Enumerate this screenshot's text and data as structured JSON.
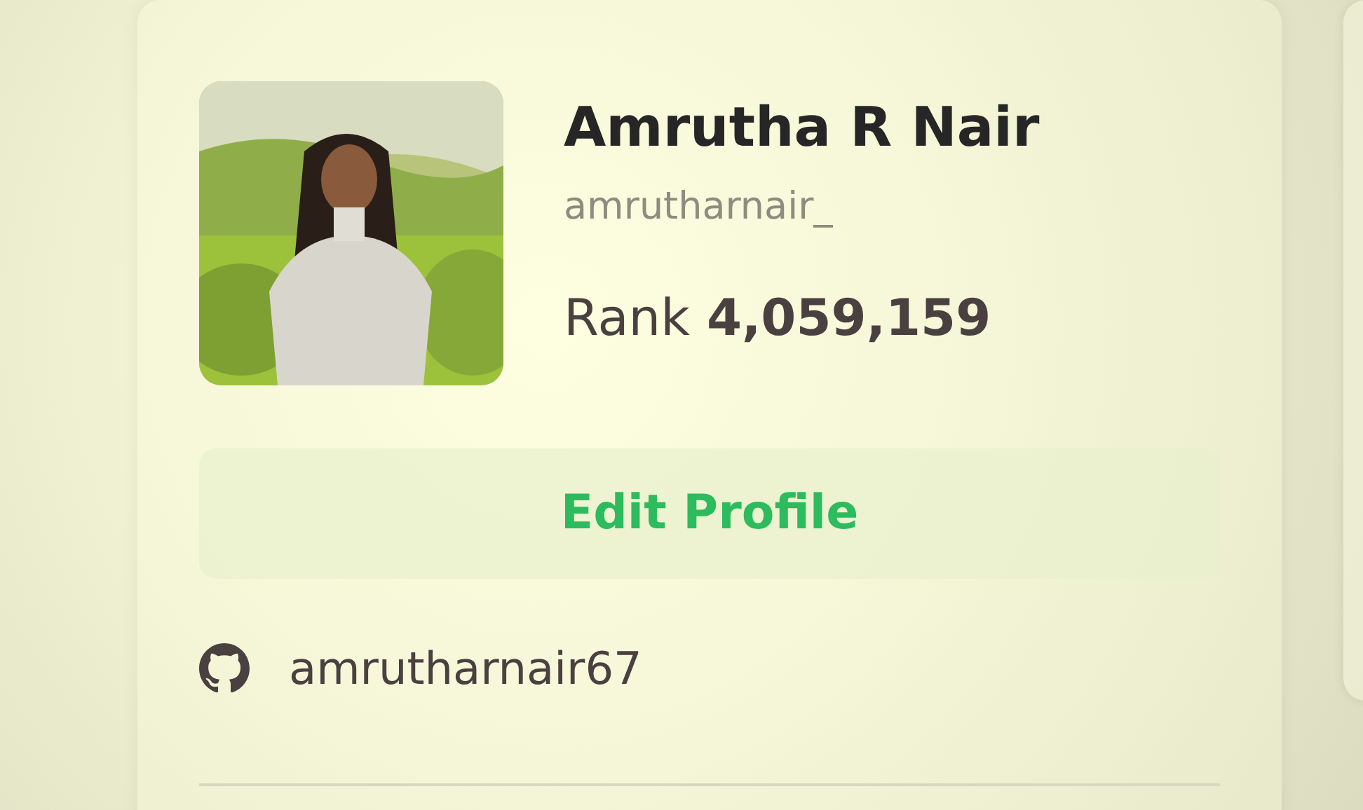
{
  "profile": {
    "name": "Amrutha R Nair",
    "username": "amrutharnair_",
    "rank_label": "Rank",
    "rank_value": "4,059,159"
  },
  "edit_button": {
    "label": "Edit Profile"
  },
  "links": [
    {
      "kind": "github",
      "text": "amrutharnair67"
    }
  ]
}
